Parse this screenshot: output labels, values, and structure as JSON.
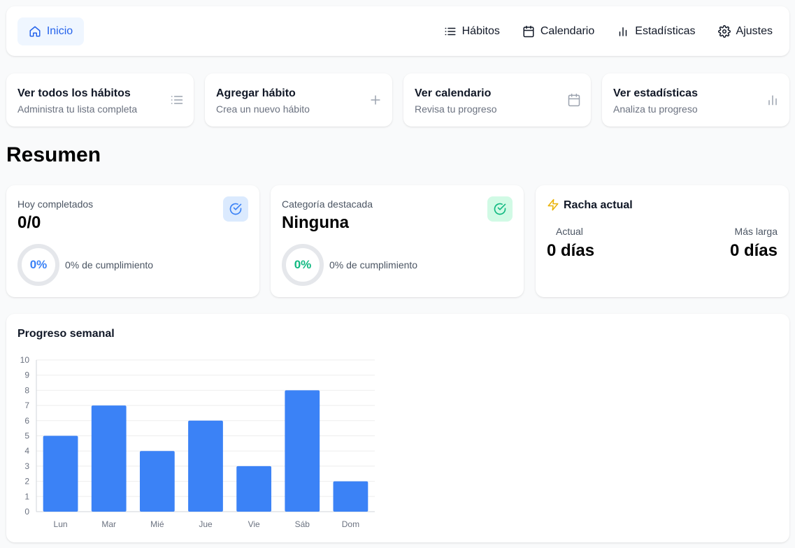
{
  "nav": {
    "home": {
      "label": "Inicio",
      "icon": "home-icon"
    },
    "links": [
      {
        "label": "Hábitos",
        "icon": "list-icon"
      },
      {
        "label": "Calendario",
        "icon": "calendar-icon"
      },
      {
        "label": "Estadísticas",
        "icon": "bar-chart-icon"
      },
      {
        "label": "Ajustes",
        "icon": "gear-icon"
      }
    ]
  },
  "quick_actions": [
    {
      "title": "Ver todos los hábitos",
      "subtitle": "Administra tu lista completa",
      "icon": "list-icon"
    },
    {
      "title": "Agregar hábito",
      "subtitle": "Crea un nuevo hábito",
      "icon": "plus-icon"
    },
    {
      "title": "Ver calendario",
      "subtitle": "Revisa tu progreso",
      "icon": "calendar-icon"
    },
    {
      "title": "Ver estadísticas",
      "subtitle": "Analiza tu progreso",
      "icon": "bar-chart-icon"
    }
  ],
  "summary": {
    "title": "Resumen",
    "today": {
      "label": "Hoy completados",
      "value": "0/0",
      "percent": "0%",
      "caption": "0% de cumplimiento",
      "color": "#3b82f6"
    },
    "category": {
      "label": "Categoría destacada",
      "value": "Ninguna",
      "percent": "0%",
      "caption": "0% de cumplimiento",
      "color": "#10b981"
    },
    "streak": {
      "title": "Racha actual",
      "current_label": "Actual",
      "current_value": "0 días",
      "longest_label": "Más larga",
      "longest_value": "0 días",
      "icon_color": "#eab308"
    }
  },
  "chart_data": {
    "type": "bar",
    "title": "Progreso semanal",
    "categories": [
      "Lun",
      "Mar",
      "Mié",
      "Jue",
      "Vie",
      "Sáb",
      "Dom"
    ],
    "values": [
      5,
      7,
      4,
      6,
      3,
      8,
      2
    ],
    "ylim": [
      0,
      10
    ],
    "yticks": [
      0,
      1,
      2,
      3,
      4,
      5,
      6,
      7,
      8,
      9,
      10
    ],
    "grid": true,
    "color": "#3b82f6"
  }
}
